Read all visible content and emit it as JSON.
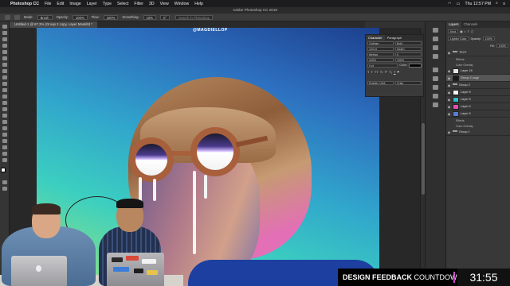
{
  "menubar": {
    "app_name": "Photoshop CC",
    "items": [
      "File",
      "Edit",
      "Image",
      "Layer",
      "Type",
      "Select",
      "Filter",
      "3D",
      "View",
      "Window",
      "Help"
    ],
    "clock": "Thu 12:57 PM"
  },
  "window": {
    "title": "Adobe Photoshop CC 2019"
  },
  "options": {
    "mode_label": "Mode:",
    "mode_value": "Brush",
    "opacity_label": "Opacity:",
    "opacity_value": "100%",
    "flow_label": "Flow:",
    "flow_value": "100%",
    "smoothing_label": "Smoothing:",
    "smoothing_value": "10%",
    "angle_value": "0°",
    "search_placeholder": "Search in Photoshop"
  },
  "document": {
    "tab_label": "Untitled-1 @ 67.2% (Group 2 copy, Layer Mask/8) *"
  },
  "artwork": {
    "watermark": "@MAGDIELLOP"
  },
  "character_panel": {
    "tabs": [
      "Character",
      "Paragraph"
    ],
    "font_family": "Gotham",
    "font_style": "Bold",
    "font_size": "124 pt",
    "leading": "(Auto)",
    "kerning": "Metrics",
    "tracking": "0",
    "vertical_scale": "100%",
    "horizontal_scale": "100%",
    "baseline": "0 pt",
    "color_label": "Color:",
    "style_buttons": [
      "T",
      "T",
      "TT",
      "Tr",
      "T¹",
      "T₁",
      "T",
      "T"
    ],
    "language": "English: USA",
    "antialias": "Crisp"
  },
  "layers_panel": {
    "tabs": [
      "Layers",
      "Channels"
    ],
    "filter_label": "Kind",
    "blend_mode": "Lighter Color",
    "opacity_label": "Opacity:",
    "opacity_value": "100%",
    "fill_label": "Fill:",
    "fill_value": "100%",
    "layers": [
      {
        "name": "TEXT",
        "kind": "group",
        "selected": false,
        "color": "#a0a0a0"
      },
      {
        "name": "Effects",
        "kind": "sub",
        "selected": false,
        "color": ""
      },
      {
        "name": "Color Overlay",
        "kind": "sub",
        "selected": false,
        "color": ""
      },
      {
        "name": "Layer 16",
        "kind": "layer",
        "selected": false,
        "color": "#e6e6e6"
      },
      {
        "name": "Group 2 copy",
        "kind": "layer",
        "selected": true,
        "color": "#1a1a1a"
      },
      {
        "name": "Group 2",
        "kind": "group",
        "selected": false,
        "color": "#a0a0a0"
      },
      {
        "name": "Layer 8",
        "kind": "layer",
        "selected": false,
        "color": "#f3f3f3"
      },
      {
        "name": "Layer 8",
        "kind": "layer",
        "selected": false,
        "color": "#30c0c8"
      },
      {
        "name": "Layer 6",
        "kind": "layer",
        "selected": false,
        "color": "#e24fb0"
      },
      {
        "name": "Layer 5",
        "kind": "layer",
        "selected": false,
        "color": "#5a7bd8"
      },
      {
        "name": "Effects",
        "kind": "sub",
        "selected": false,
        "color": ""
      },
      {
        "name": "Color Overlay",
        "kind": "sub",
        "selected": false,
        "color": ""
      },
      {
        "name": "Group 1",
        "kind": "group",
        "selected": false,
        "color": "#a0a0a0"
      }
    ]
  },
  "overlay": {
    "banner_bold": "DESIGN FEEDBACK",
    "banner_regular": " COUNTDOWN",
    "timer": "31:55"
  }
}
